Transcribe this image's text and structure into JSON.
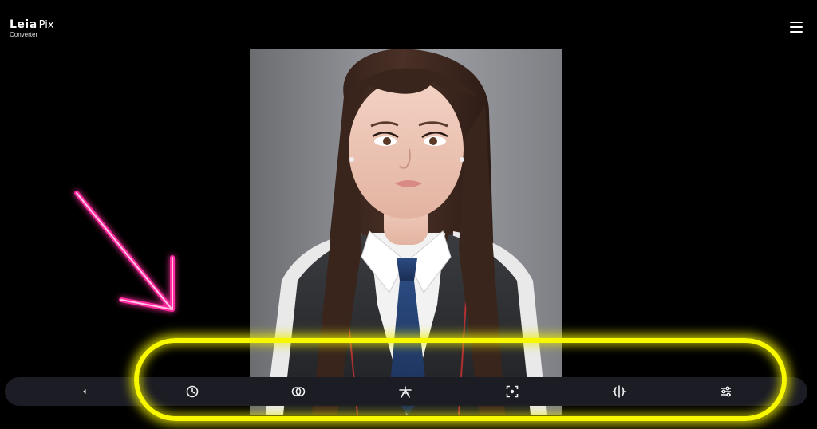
{
  "app": {
    "brand": "Leia",
    "product": "Pix",
    "subtitle": "Converter"
  },
  "header": {
    "menu_icon": "hamburger-menu-icon"
  },
  "toolbar": {
    "items": [
      {
        "icon": "chevron-left-icon"
      },
      {
        "icon": "clock-icon"
      },
      {
        "icon": "overlap-circles-icon"
      },
      {
        "icon": "perspective-icon"
      },
      {
        "icon": "focus-frame-icon"
      },
      {
        "icon": "depth-split-icon"
      },
      {
        "icon": "sliders-icon"
      }
    ]
  },
  "colors": {
    "background": "#000000",
    "toolbar": "#1b1c24",
    "highlight": "#f7f700",
    "arrow": "#ff2a9d"
  }
}
